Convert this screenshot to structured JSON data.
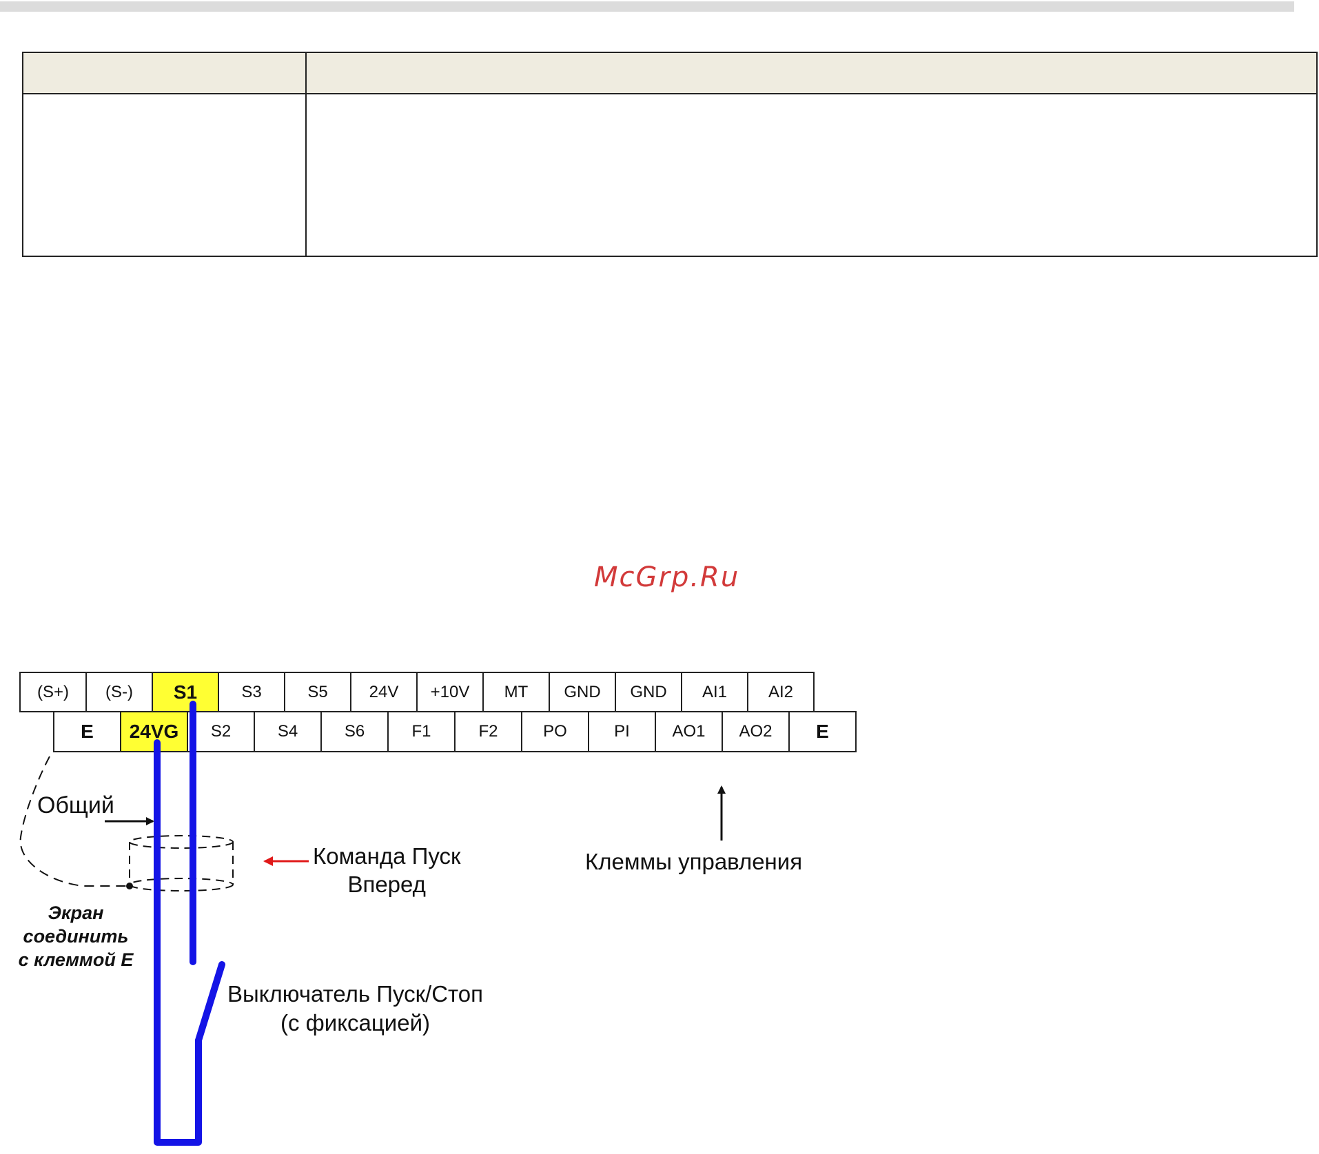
{
  "watermark": "McGrp.Ru",
  "terminals": {
    "top_row": [
      "(S+)",
      "(S-)",
      "S1",
      "S3",
      "S5",
      "24V",
      "+10V",
      "MT",
      "GND",
      "GND",
      "AI1",
      "AI2"
    ],
    "bottom_row": [
      "E",
      "24VG",
      "S2",
      "S4",
      "S6",
      "F1",
      "F2",
      "PO",
      "PI",
      "AO1",
      "AO2",
      "E"
    ],
    "highlight_color": "#ffff33"
  },
  "labels": {
    "common": "Общий",
    "command_line1": "Команда Пуск",
    "command_line2": "Вперед",
    "control_terminals": "Клеммы управления",
    "screen_line1": "Экран",
    "screen_line2": "соединить",
    "screen_line3": "с клеммой E",
    "switch_line1": "Выключатель Пуск/Стоп",
    "switch_line2": "(с фиксацией)"
  },
  "colors": {
    "wire": "#1414e6",
    "arrow_red": "#e01919",
    "header_fill": "#efece0"
  }
}
